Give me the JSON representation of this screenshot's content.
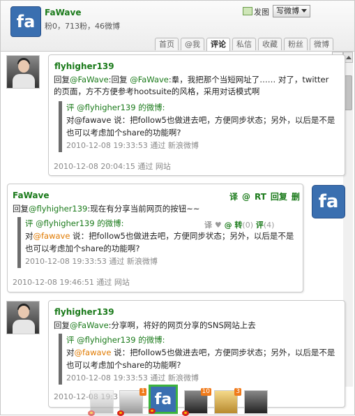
{
  "header": {
    "username": "FaWave",
    "stats": "粉0，713粉，46微博",
    "post_image_label": "发图",
    "write_button_label": "写微博",
    "tabs": [
      {
        "label": "首页",
        "active": false
      },
      {
        "label": "@我",
        "active": false
      },
      {
        "label": "评论",
        "active": true
      },
      {
        "label": "私信",
        "active": false
      },
      {
        "label": "收藏",
        "active": false
      },
      {
        "label": "粉丝",
        "active": false
      },
      {
        "label": "微博",
        "active": false
      }
    ]
  },
  "avatar_logo_text": "fa",
  "comments": [
    {
      "username": "flyhigher139",
      "reply_prefix": "回复",
      "reply_mention": "@FaWave",
      "text_1": ":回复 ",
      "text_mention_2": "@FaWave",
      "text_2": ":羣，我把那个当短网址了…… 对了，twitter的页面，方不方便参考hootsuite的风格，采用对话模式啊",
      "quote": {
        "label": "评",
        "author": "@flyhigher139",
        "suffix": "的微博:",
        "body": "对@fawave 说：把follow5也做进去吧，方便同步状态；另外，以后是不是也可以考虑加个share的功能啊?",
        "meta": "2010-12-08 19:33:53 通过 新浪微博"
      },
      "footer": "2010-12-08 20:04:15 通过 网站"
    },
    {
      "username": "FaWave",
      "actions": [
        "译",
        "@",
        "RT",
        "回复",
        "删"
      ],
      "reply_prefix": "回复",
      "reply_mention": "@flyhigher139",
      "text": ":现在有分享当前网页的按钮~~",
      "quote": {
        "label": "评",
        "author": "@flyhigher139",
        "suffix": "的微博:",
        "body_pre": "对",
        "body_mention": "@fawave",
        "body": " 说：把follow5也做进去吧，方便同步状态；另外，以后是不是也可以考虑加个share的功能啊?",
        "meta": "2010-12-08 19:33:53 通过 新浪微博",
        "actions": {
          "translate": "译",
          "heart": "♥",
          "at": "@",
          "repost": "转",
          "repost_count": "(0)",
          "comment": "评",
          "comment_count": "(4)"
        }
      },
      "footer": "2010-12-08 19:46:51 通过 网站"
    },
    {
      "username": "flyhigher139",
      "reply_prefix": "回复",
      "reply_mention": "@FaWave",
      "text": ":分享啊，将好的网页分享的SNS网站上去",
      "quote": {
        "label": "评",
        "author": "@flyhigher139",
        "suffix": "的微博:",
        "body_pre": "对",
        "body_mention": "@fawave",
        "body": " 说：把follow5也做进去吧，方便同步状态；另外，以后是不是也可以考虑加个share的功能啊?",
        "meta": "2010-12-08 19:33:53 通过 新浪微博"
      },
      "footer": "2010-12-08 19:3"
    }
  ],
  "account_bar": {
    "badges": [
      "1",
      "10",
      "3"
    ]
  },
  "colors": {
    "accent_green": "#1a7a1a",
    "mention_orange": "#e07a00",
    "selected_border": "#3db33d",
    "logo_blue": "#3a6fb0"
  }
}
